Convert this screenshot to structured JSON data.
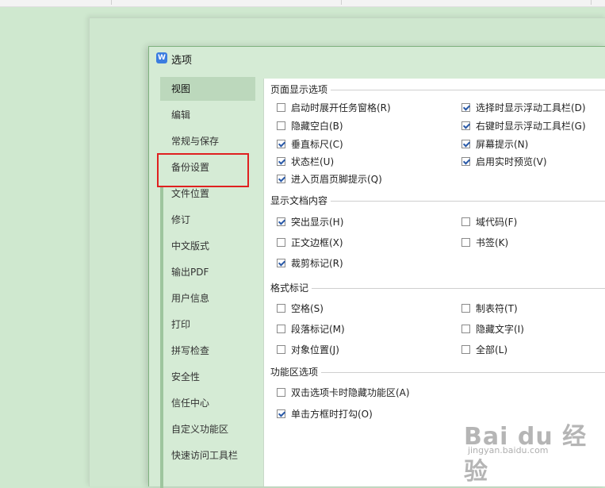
{
  "dialog": {
    "title": "选项",
    "app_icon": "W"
  },
  "sidebar": {
    "items": [
      {
        "label": "视图",
        "active": true
      },
      {
        "label": "编辑"
      },
      {
        "label": "常规与保存"
      },
      {
        "label": "备份设置"
      },
      {
        "label": "文件位置"
      },
      {
        "label": "修订"
      },
      {
        "label": "中文版式"
      },
      {
        "label": "输出PDF"
      },
      {
        "label": "用户信息"
      },
      {
        "label": "打印"
      },
      {
        "label": "拼写检查"
      },
      {
        "label": "安全性"
      },
      {
        "label": "信任中心"
      },
      {
        "label": "自定义功能区"
      },
      {
        "label": "快速访问工具栏"
      }
    ]
  },
  "sections": {
    "page_display": {
      "title": "页面显示选项",
      "options": [
        {
          "label": "启动时展开任务窗格(R)",
          "checked": false
        },
        {
          "label": "选择时显示浮动工具栏(D)",
          "checked": true
        },
        {
          "label": "隐藏空白(B)",
          "checked": false
        },
        {
          "label": "右键时显示浮动工具栏(G)",
          "checked": true
        },
        {
          "label": "垂直标尺(C)",
          "checked": true
        },
        {
          "label": "屏幕提示(N)",
          "checked": true
        },
        {
          "label": "状态栏(U)",
          "checked": true
        },
        {
          "label": "启用实时预览(V)",
          "checked": true
        },
        {
          "label": "进入页眉页脚提示(Q)",
          "checked": true
        }
      ]
    },
    "doc_content": {
      "title": "显示文档内容",
      "options": [
        {
          "label": "突出显示(H)",
          "checked": true
        },
        {
          "label": "域代码(F)",
          "checked": false
        },
        {
          "label": "正文边框(X)",
          "checked": false
        },
        {
          "label": "书签(K)",
          "checked": false
        },
        {
          "label": "裁剪标记(R)",
          "checked": true
        }
      ]
    },
    "format_marks": {
      "title": "格式标记",
      "options": [
        {
          "label": "空格(S)",
          "checked": false
        },
        {
          "label": "制表符(T)",
          "checked": false
        },
        {
          "label": "段落标记(M)",
          "checked": false
        },
        {
          "label": "隐藏文字(I)",
          "checked": false
        },
        {
          "label": "对象位置(J)",
          "checked": false
        },
        {
          "label": "全部(L)",
          "checked": false
        }
      ]
    },
    "ribbon": {
      "title": "功能区选项",
      "options": [
        {
          "label": "双击选项卡时隐藏功能区(A)",
          "checked": false
        },
        {
          "label": "单击方框时打勾(O)",
          "checked": true
        }
      ]
    }
  },
  "watermark": {
    "logo": "Bai du 经验",
    "url": "jingyan.baidu.com"
  }
}
